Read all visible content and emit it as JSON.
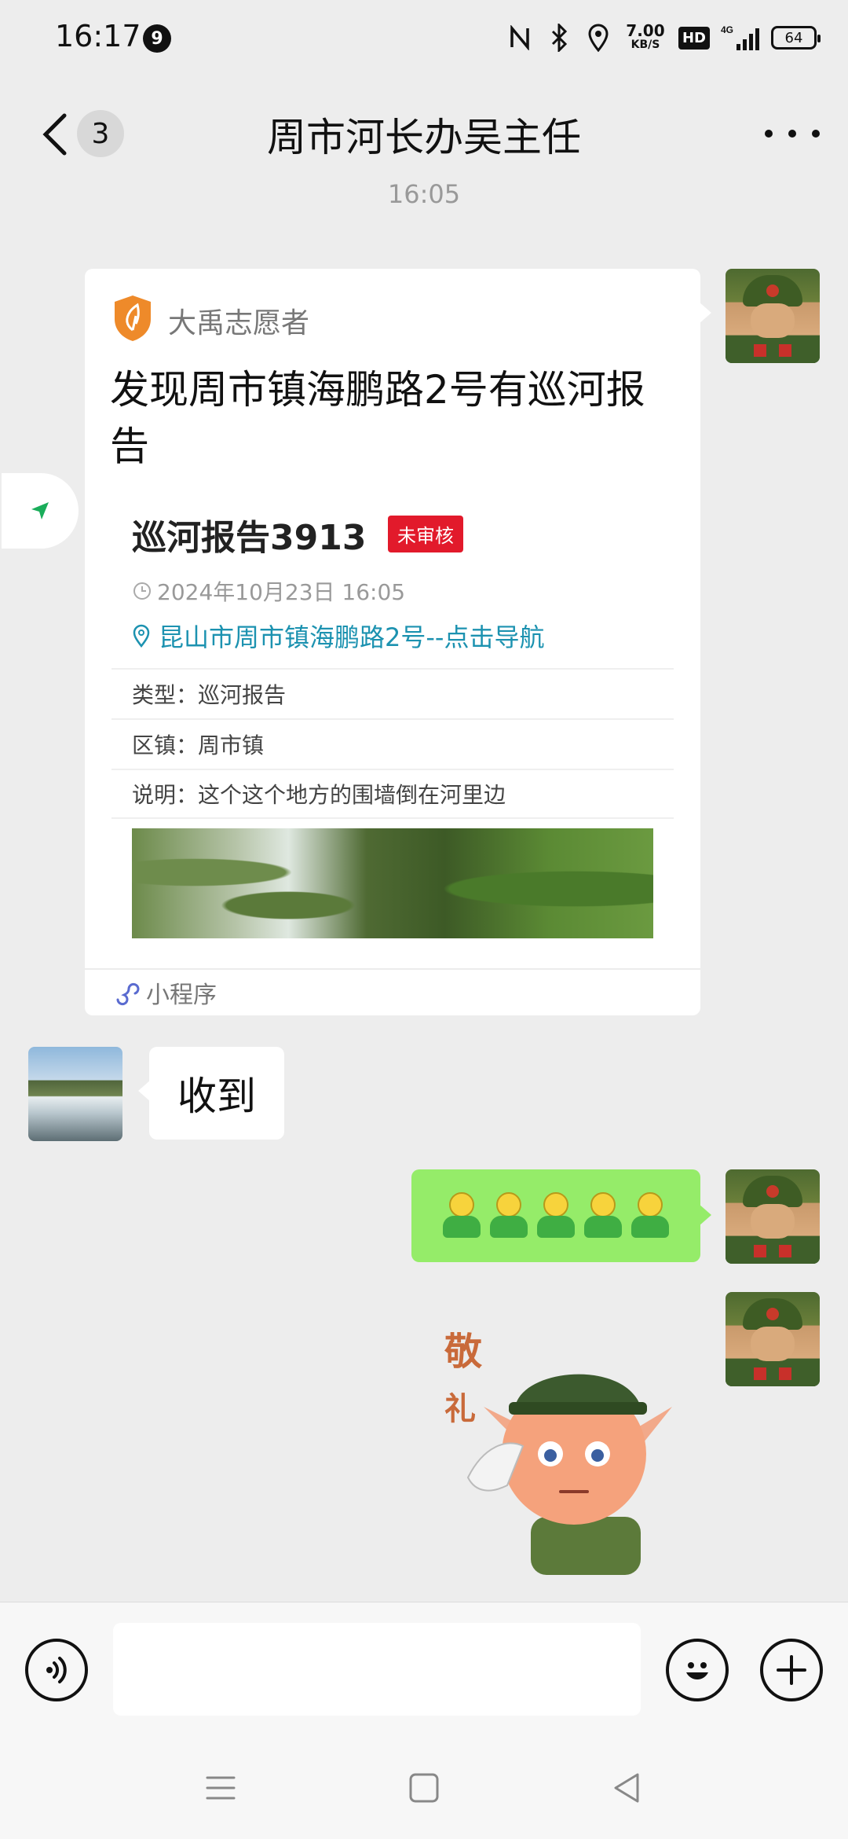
{
  "status_bar": {
    "time": "16:17",
    "notification_count": "9",
    "net_speed_value": "7.00",
    "net_speed_unit": "KB/S",
    "hd_label": "HD",
    "network_label": "4G",
    "battery": "64"
  },
  "header": {
    "unread_count": "3",
    "title": "周市河长办吴主任"
  },
  "timestamp": "16:05",
  "mini_program_card": {
    "brand": "大禹志愿者",
    "title": "发现周市镇海鹏路2号有巡河报告",
    "report_title": "巡河报告3913",
    "status_badge": "未审核",
    "date": "2024年10月23日 16:05",
    "location": "昆山市周市镇海鹏路2号--点击导航",
    "rows": [
      {
        "label": "类型：",
        "value": "巡河报告"
      },
      {
        "label": "区镇：",
        "value": "周市镇"
      },
      {
        "label": "说明：",
        "value": "这个这个地方的围墙倒在河里边"
      }
    ],
    "footer": "小程序"
  },
  "received_message": "收到",
  "sent_emoji_count": 5,
  "sticker_text": [
    "敬",
    "礼"
  ],
  "colors": {
    "background": "#ededed",
    "sent_bubble": "#95ec69",
    "badge_red": "#e21a2b",
    "link_teal": "#1c92b0",
    "brand_orange": "#ee8a2a"
  },
  "icons": {
    "back": "chevron-left-icon",
    "more": "more-dots-icon",
    "voice": "voice-icon",
    "emoji": "smile-icon",
    "plus": "plus-icon",
    "nav_menu": "menu-icon",
    "nav_home": "home-square-icon",
    "nav_back": "back-triangle-icon"
  }
}
